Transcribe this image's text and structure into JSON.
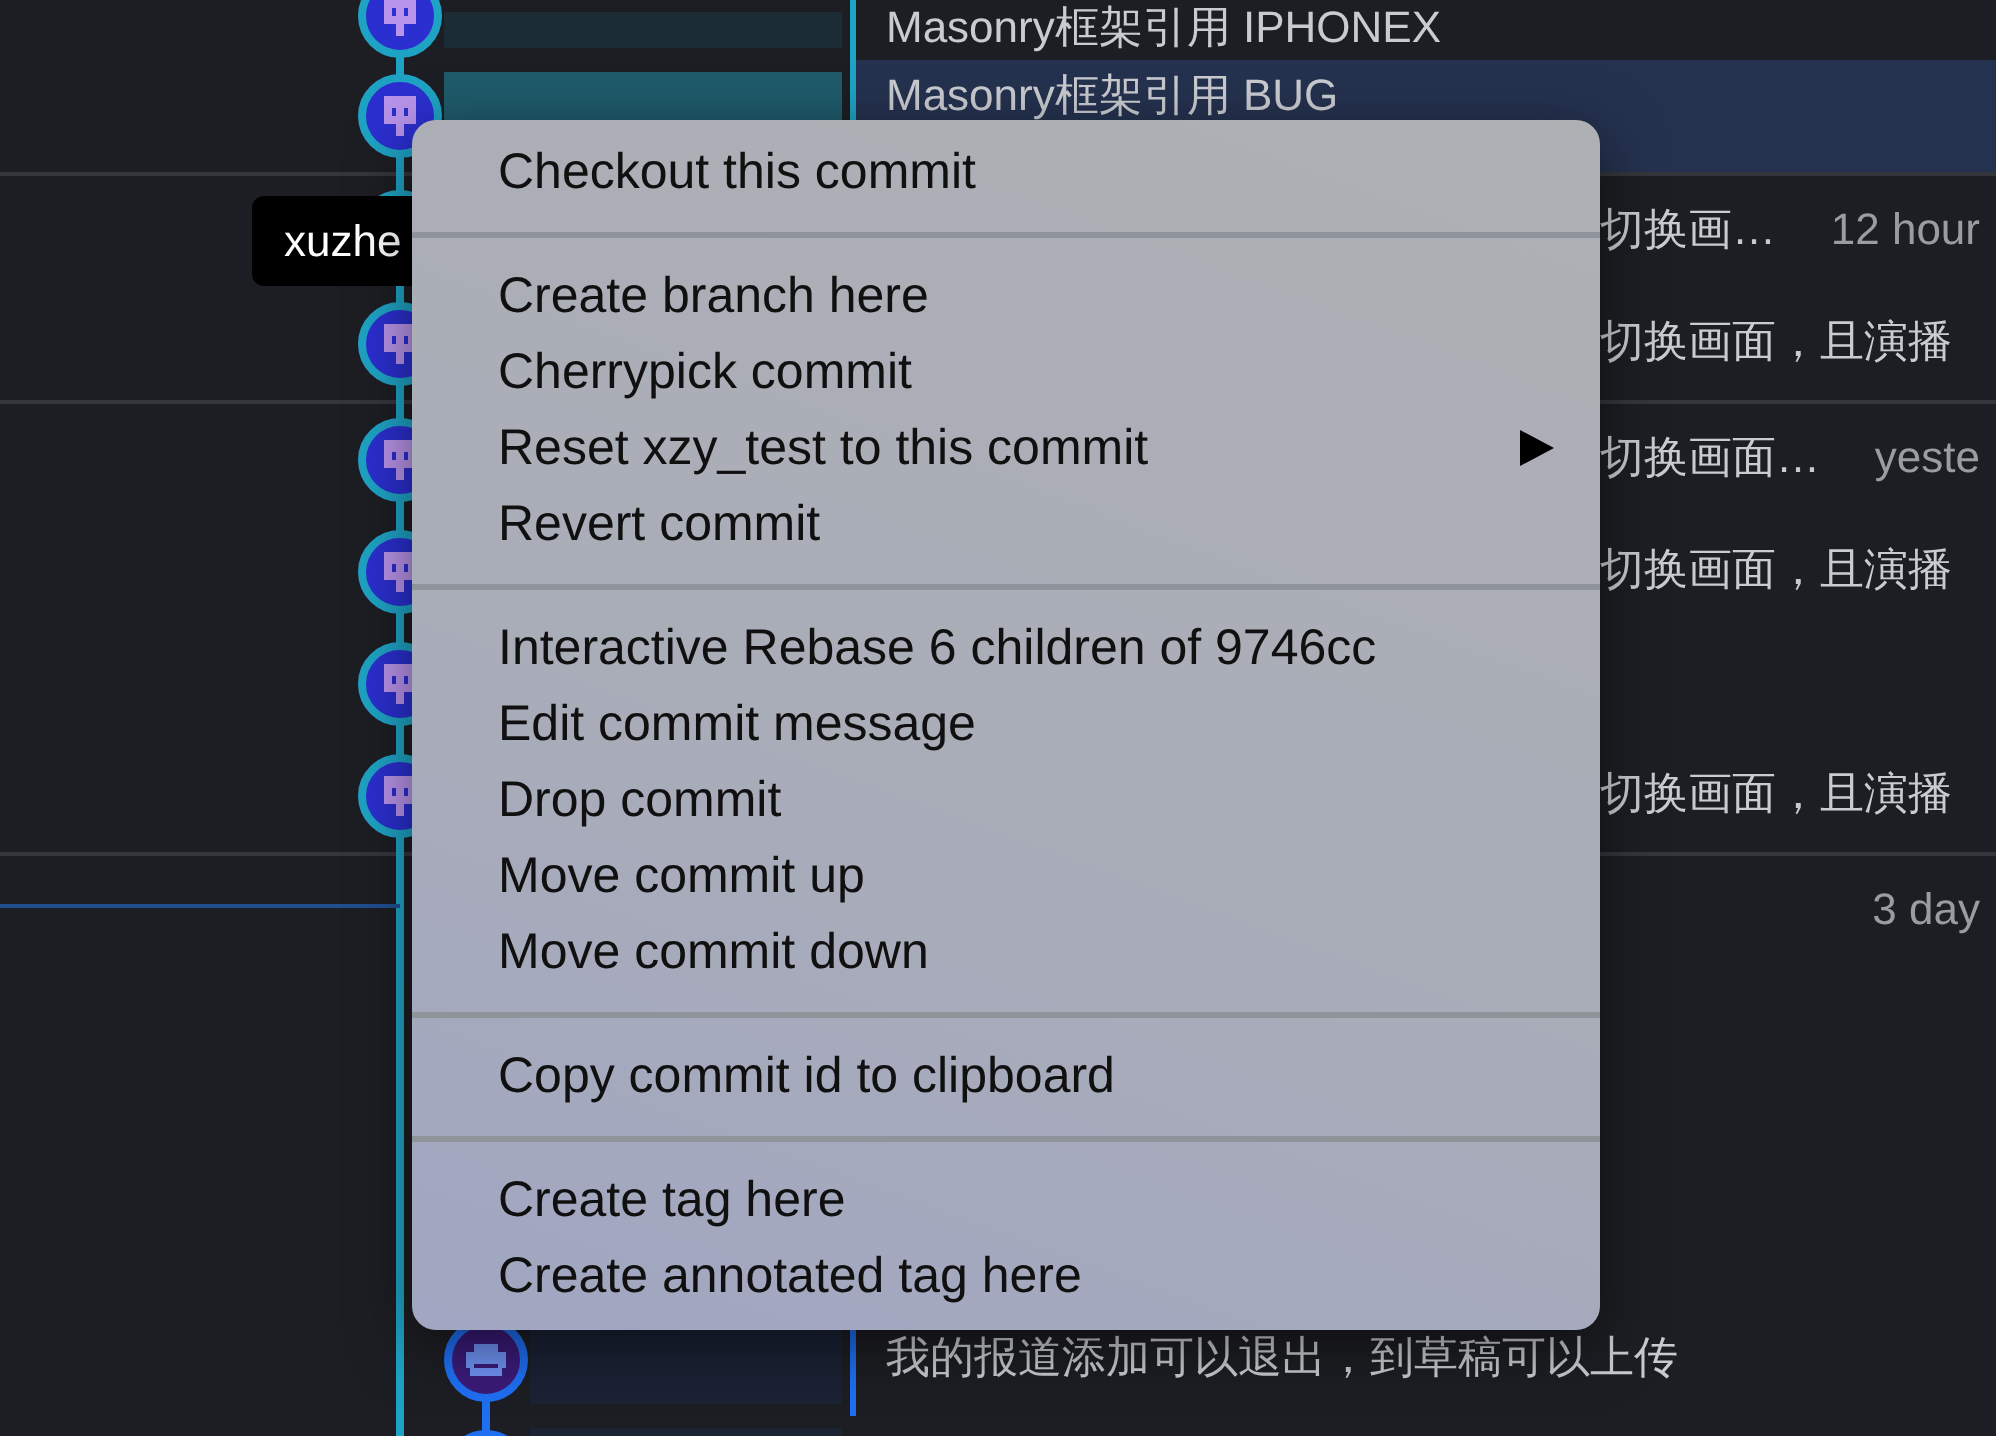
{
  "graph": {
    "groups": [
      {
        "rows": [
          {
            "kind": "main",
            "selected": false,
            "message": "Masonry框架引用 IPHONEX"
          },
          {
            "kind": "main",
            "selected": true,
            "message": "Masonry框架引用 BUG"
          }
        ]
      },
      {
        "rows": [
          {
            "kind": "main",
            "selected": false,
            "message_tail": "切换画…",
            "time": "12 hour"
          },
          {
            "kind": "main",
            "selected": false,
            "message_tail": "切换画面，且演播"
          }
        ]
      },
      {
        "rows": [
          {
            "kind": "main",
            "selected": false,
            "message_tail": "切换画面…",
            "time": "yeste"
          },
          {
            "kind": "main",
            "selected": false,
            "message_tail": "切换画面，且演播"
          },
          {
            "kind": "main",
            "selected": false
          },
          {
            "kind": "main",
            "selected": false,
            "message_tail": "切换画面，且演播"
          }
        ]
      },
      {
        "rows": [
          {
            "kind": "hidden",
            "selected": false,
            "time": "3 day"
          },
          {
            "kind": "feature",
            "selected": false,
            "message": "我的报道添加可以退出，到草稿可以上传"
          },
          {
            "kind": "feature",
            "selected": false
          }
        ]
      }
    ]
  },
  "tooltip": {
    "text": "xuzhe"
  },
  "context_menu": {
    "sections": [
      {
        "items": [
          {
            "label": "Checkout this commit",
            "submenu": false
          }
        ]
      },
      {
        "items": [
          {
            "label": "Create branch here",
            "submenu": false
          },
          {
            "label": "Cherrypick commit",
            "submenu": false
          },
          {
            "label": "Reset xzy_test to this commit",
            "submenu": true
          },
          {
            "label": "Revert commit",
            "submenu": false
          }
        ]
      },
      {
        "items": [
          {
            "label": "Interactive Rebase 6 children of 9746cc",
            "submenu": false
          },
          {
            "label": "Edit commit message",
            "submenu": false
          },
          {
            "label": "Drop commit",
            "submenu": false
          },
          {
            "label": "Move commit up",
            "submenu": false
          },
          {
            "label": "Move commit down",
            "submenu": false
          }
        ]
      },
      {
        "items": [
          {
            "label": "Copy commit id to clipboard",
            "submenu": false
          }
        ]
      },
      {
        "items": [
          {
            "label": "Create tag here",
            "submenu": false
          },
          {
            "label": "Create annotated tag here",
            "submenu": false
          }
        ]
      }
    ]
  }
}
